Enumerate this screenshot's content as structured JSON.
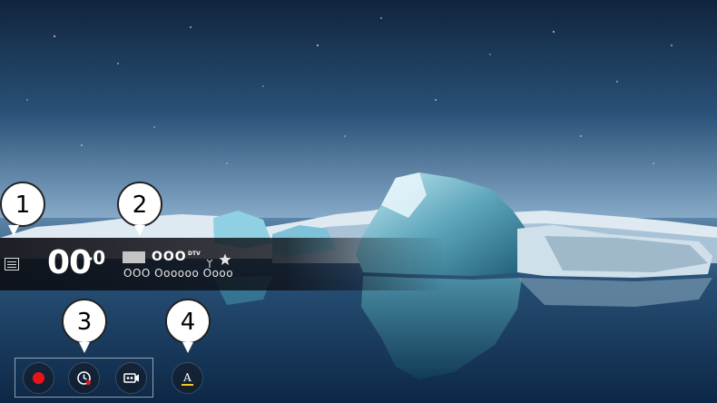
{
  "channel_bar": {
    "menu_icon": "list-icon",
    "channel_number": "00",
    "channel_sub_number": "-0",
    "channel_name": "OOO",
    "dtv_label": "DTV",
    "signal_icon": "antenna-icon",
    "favorite_icon": "star-icon",
    "program_title": "OOO Oooooo Oooo"
  },
  "controls": {
    "record_icon": "record-icon",
    "timer_icon": "timer-record-icon",
    "recordings_icon": "recordings-icon",
    "audio_desc_icon": "audio-description-icon",
    "record_color": "#e8141c",
    "accent_color": "#f0c81e"
  },
  "callouts": [
    "1",
    "2",
    "3",
    "4"
  ]
}
